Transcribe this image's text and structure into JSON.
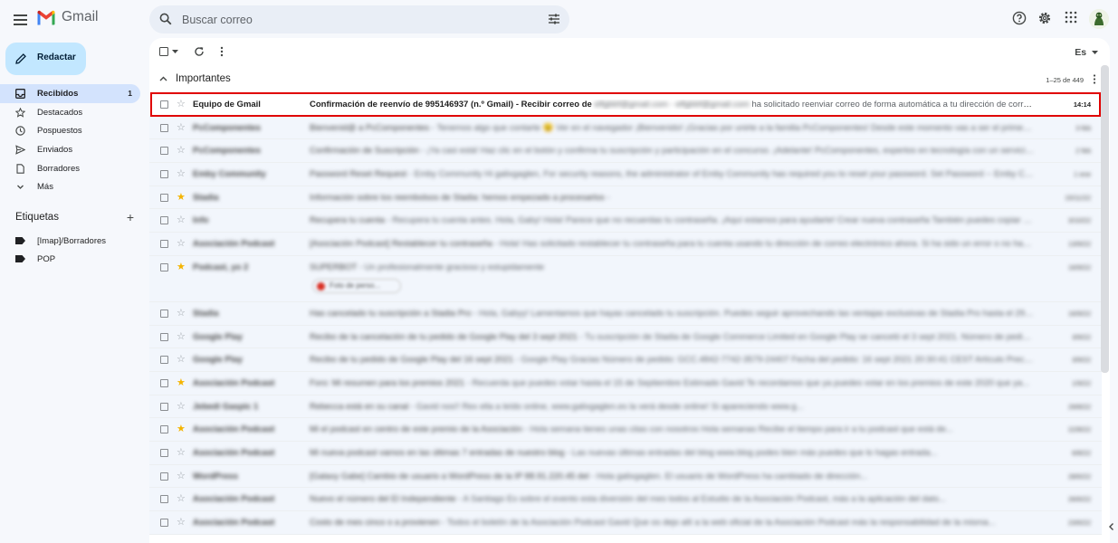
{
  "app": {
    "name": "Gmail"
  },
  "search": {
    "placeholder": "Buscar correo"
  },
  "compose": {
    "label": "Redactar"
  },
  "nav": [
    {
      "name": "inbox",
      "label": "Recibidos",
      "count": "1",
      "icon": "inbox-icon"
    },
    {
      "name": "starred",
      "label": "Destacados",
      "count": "",
      "icon": "star-icon"
    },
    {
      "name": "snoozed",
      "label": "Pospuestos",
      "count": "",
      "icon": "clock-icon"
    },
    {
      "name": "sent",
      "label": "Enviados",
      "count": "",
      "icon": "send-icon"
    },
    {
      "name": "drafts",
      "label": "Borradores",
      "count": "",
      "icon": "file-icon"
    },
    {
      "name": "more",
      "label": "Más",
      "count": "",
      "icon": "chevron-down-icon"
    }
  ],
  "labels": {
    "title": "Etiquetas",
    "items": [
      "[Imap]/Borradores",
      "POP"
    ]
  },
  "toolbar": {
    "sort_label": "Es"
  },
  "section": {
    "title": "Importantes",
    "range": "1–25 de 449"
  },
  "emails": [
    {
      "sender": "Equipo de Gmail",
      "subject": "Confirmación de reenvío de 995146937 (n.º Gmail) - Recibir correo de",
      "subject_hidden": "elfgbbf@gmail.com",
      "snippet_hidden": " - elfgbbf@gmail.com",
      "snippet": " ha solicitado reenviar correo de forma automática a tu dirección de corre...",
      "date": "14:14",
      "unread": true,
      "starred": false
    },
    {
      "sender": "PcComponentes",
      "subject": "Bienvenid@ a PcComponentes",
      "snippet": " - Tenemos algo que contarte 😉 Ver en el navegador ¡Bienvenido! ¡Gracias por unirte a la familia PcComponentes! Desde este momento vas a ser el primero en ente...",
      "date": "3 feb",
      "unread": false,
      "starred": false
    },
    {
      "sender": "PcComponentes",
      "subject": "Confirmación de Suscripción",
      "snippet": " - ¡Ya casi está! Haz clic en el botón y confirma tu suscripción y participación en el concurso. ¡Adelante! PcComponentes, expertos en tecnología con un servicio 5",
      "date": "2 feb",
      "unread": false,
      "starred": false
    },
    {
      "sender": "Emby Community",
      "subject": "Password Reset Request",
      "snippet": " - Emby Community Hi galixgaglen, For security reasons, the administrator of Emby Community has required you to reset your password. Set Password -- Emby Communi...",
      "date": "1 ene",
      "unread": false,
      "starred": false
    },
    {
      "sender": "Stadia",
      "subject": "Información sobre los reembolsos de Stadia: hemos empezado a procesarlos",
      "snippet": " - ",
      "date": "15/11/22",
      "unread": false,
      "starred": true
    },
    {
      "sender": "Info",
      "subject": "Recupera tu cuenta",
      "snippet": " - Recupera tu cuenta antes. Hola, Gaby! Hola! Parece que no recuerdas tu contraseña. ¡Aquí estamos para ayudarte! Crear nueva contraseña También puedes copiar y pegar",
      "date": "3/10/22",
      "unread": false,
      "starred": false
    },
    {
      "sender": "Asociación Podcast",
      "subject": "[Asociación Podcast] Restablecer tu contraseña",
      "snippet": " - Hola! Has solicitado restablecer tu contraseña para tu cuenta usando tu dirección de correo electrónico ahora. Si ha sido un error o no has sol...",
      "date": "13/9/22",
      "unread": false,
      "starred": false
    },
    {
      "sender": "Podcast, yo 2",
      "subject": "SUPERBOT",
      "snippet": " - Un profesionalmente gracioso y estupidamente",
      "date": "16/9/22",
      "unread": false,
      "starred": true,
      "attachment": "Foto de perso..."
    },
    {
      "sender": "Stadia",
      "subject": "Has cancelado tu suscripción a Stadia Pro",
      "snippet": " - Hola, Gabyy! Lamentamos que hayas cancelado tu suscripción. Puedes seguir aprovechando las ventajas exclusivas de Stadia Pro hasta el 29 sep 2022...",
      "date": "16/9/22",
      "unread": false,
      "starred": false
    },
    {
      "sender": "Google Play",
      "subject": "Recibo de la cancelación de tu pedido de Google Play del 3 sept 2021",
      "snippet": " - Tu suscripción de Stadia de Google Commerce Limited en Google Play se canceló el 3 sept 2021. Número de pedido: GCS...",
      "date": "3/9/22",
      "unread": false,
      "starred": false
    },
    {
      "sender": "Google Play",
      "subject": "Recibo de tu pedido de Google Play del 16 sept 2021",
      "snippet": " - Google Play Gracias Número de pedido: GCC.4842-7742-3579-24407 Fecha del pedido: 16 sept 2021 20:30:41 CEST Artículo Precio Stadia Pro...",
      "date": "3/9/22",
      "unread": false,
      "starred": false
    },
    {
      "sender": "Asociación Podcast",
      "subject": "Foro: Mi resumen para los premios 2021",
      "snippet": " - Recuerda que puedes votar hasta el 15 de Septiembre Estimado Gavid Te recordamos que ya puedes votar en los premios de este 2020 que ya...",
      "date": "1/9/22",
      "unread": false,
      "starred": true
    },
    {
      "sender": "Jebedi Gaspic 1",
      "subject": "Rebecca está en su canal",
      "snippet": " - Gavid nos!! Rex ella a leído online, www.galixgaglen.es la verá desde online! Si apareciendo www.g...",
      "date": "29/8/22",
      "unread": false,
      "starred": false
    },
    {
      "sender": "Asociación Podcast",
      "subject": "Mi el podcast en centro de este premio de la Asociación",
      "snippet": " - Hola semana tienes unas citas con nosotros Hola semanas Recibe el tiempo para ir a tu podcast que está de...",
      "date": "22/8/22",
      "unread": false,
      "starred": true
    },
    {
      "sender": "Asociación Podcast",
      "subject": "Mi nueva podcast vamos en las últimas 7 entradas de nuestro blog",
      "snippet": " - Las nuevas últimas entradas del blog www.blog podes bien más puedes que lo hagas entrada...",
      "date": "6/8/22",
      "unread": false,
      "starred": false
    },
    {
      "sender": "WordPress",
      "subject": "[Galaxy Gabe] Cambio de usuario a WordPress de la IP 88.91.220.45 del",
      "snippet": " - Hola galixgaglen. El usuario de WordPress ha cambiado de dirección...",
      "date": "28/6/22",
      "unread": false,
      "starred": false
    },
    {
      "sender": "Asociación Podcast",
      "subject": "Nuevo el número del El Independiente",
      "snippet": " - A Santiago Es sobre el evento esta diversión del mes todos al Estudio de la Asociación Podcast, más a la aplicación del dato...",
      "date": "26/6/22",
      "unread": false,
      "starred": false
    },
    {
      "sender": "Asociación Podcast",
      "subject": "Costo de mes cinco o a provienen",
      "snippet": " - Todos el boletín de la Asociación Podcast Gavid Que os dejo allí a la web oficial de la Asociación Podcast más la responsabilidad de la misma...",
      "date": "23/6/22",
      "unread": false,
      "starred": false
    }
  ]
}
